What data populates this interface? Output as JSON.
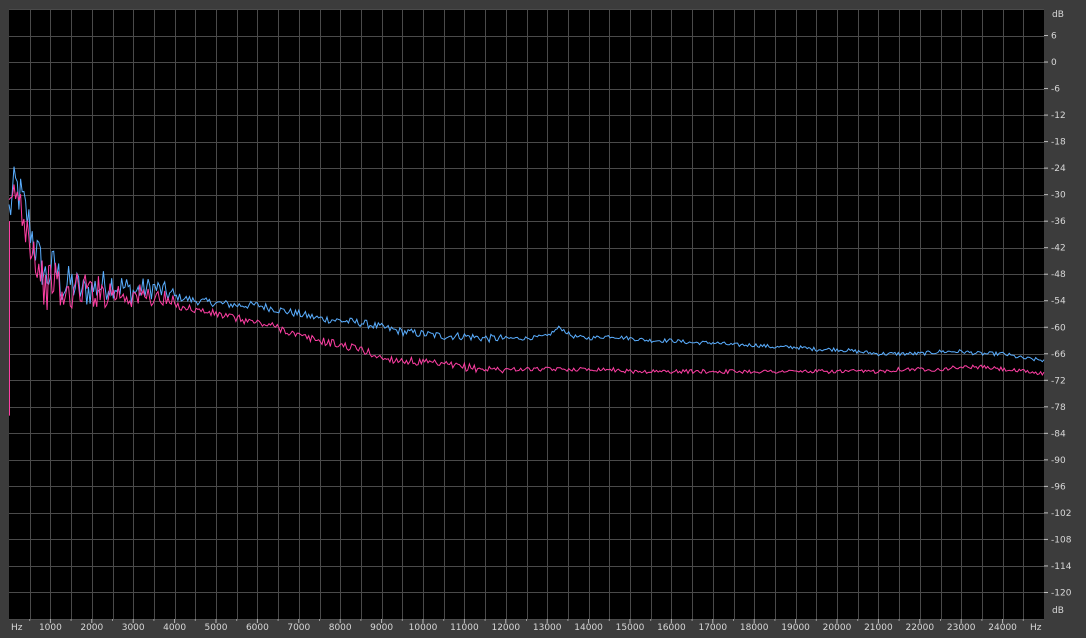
{
  "chart_data": {
    "type": "line",
    "x_axis": {
      "unit_label": "Hz",
      "unit_label_right": "Hz",
      "ticks": [
        1000,
        2000,
        3000,
        4000,
        5000,
        6000,
        7000,
        8000,
        9000,
        10000,
        11000,
        12000,
        13000,
        14000,
        15000,
        16000,
        17000,
        18000,
        19000,
        20000,
        21000,
        22000,
        23000,
        24000
      ],
      "range": [
        0,
        25000
      ]
    },
    "y_axis": {
      "unit_label": "dB",
      "unit_label_bottom": "dB",
      "ticks": [
        6,
        0,
        -6,
        -12,
        -18,
        -24,
        -30,
        -36,
        -42,
        -48,
        -54,
        -60,
        -66,
        -72,
        -78,
        -84,
        -90,
        -96,
        -102,
        -108,
        -114,
        -120
      ],
      "range": [
        -126,
        12
      ]
    },
    "grid": true,
    "colors": {
      "plot_bg": "#000000",
      "grid": "#4a4a4a",
      "frame": "#3c3c3c",
      "tick_text": "#d8d8d8"
    },
    "series": [
      {
        "color": "#5aaeff",
        "x": [
          0,
          150,
          300,
          500,
          700,
          900,
          1100,
          1300,
          1500,
          1800,
          2100,
          2500,
          3000,
          3500,
          4000,
          4500,
          5000,
          5500,
          6000,
          6500,
          7000,
          7500,
          8000,
          8500,
          9000,
          9500,
          10000,
          10500,
          11000,
          11500,
          12000,
          12500,
          13000,
          13300,
          13600,
          14000,
          14500,
          15000,
          15500,
          16000,
          16500,
          17000,
          17500,
          18000,
          18500,
          19000,
          19500,
          20000,
          20500,
          21000,
          21500,
          22000,
          22500,
          23000,
          23500,
          24000,
          24500,
          25000
        ],
        "y": [
          -34,
          -28,
          -31,
          -37,
          -44,
          -49,
          -46,
          -51,
          -50,
          -52,
          -51,
          -50,
          -52,
          -51,
          -53,
          -54,
          -54.5,
          -55,
          -55,
          -56,
          -57,
          -58,
          -58.5,
          -59,
          -60,
          -61,
          -61.5,
          -62,
          -62,
          -62.5,
          -62.5,
          -62.5,
          -62,
          -60,
          -62,
          -62.5,
          -62,
          -62.5,
          -63,
          -63,
          -63.5,
          -63.5,
          -64,
          -64,
          -64.5,
          -64.5,
          -65,
          -65,
          -65.5,
          -66,
          -66,
          -66,
          -65.5,
          -65.5,
          -66,
          -66,
          -67,
          -67.5
        ]
      },
      {
        "color": "#ff3fa4",
        "x": [
          0,
          150,
          300,
          500,
          700,
          900,
          1100,
          1300,
          1500,
          1800,
          2100,
          2500,
          3000,
          3500,
          4000,
          4500,
          5000,
          5500,
          6000,
          6500,
          7000,
          7500,
          8000,
          8500,
          9000,
          9500,
          10000,
          10500,
          11000,
          11500,
          12000,
          12500,
          13000,
          13500,
          14000,
          14500,
          15000,
          15500,
          16000,
          16500,
          17000,
          17500,
          18000,
          18500,
          19000,
          19500,
          20000,
          20500,
          21000,
          21500,
          22000,
          22500,
          23000,
          23500,
          24000,
          24500,
          25000
        ],
        "y": [
          -36,
          -29,
          -33,
          -39,
          -46,
          -52,
          -48,
          -54,
          -52,
          -51,
          -52,
          -52,
          -53,
          -53,
          -55,
          -56,
          -57,
          -58,
          -59,
          -60,
          -62,
          -63,
          -64,
          -65,
          -67,
          -67.5,
          -68,
          -68.5,
          -69,
          -69.5,
          -69.5,
          -69.5,
          -69.5,
          -69.5,
          -69.5,
          -69.5,
          -70,
          -70,
          -70,
          -70,
          -70,
          -70,
          -70,
          -70,
          -70,
          -70,
          -70,
          -70,
          -70,
          -69.5,
          -69.5,
          -69.5,
          -69,
          -69,
          -69.5,
          -70,
          -70.5
        ]
      }
    ]
  }
}
